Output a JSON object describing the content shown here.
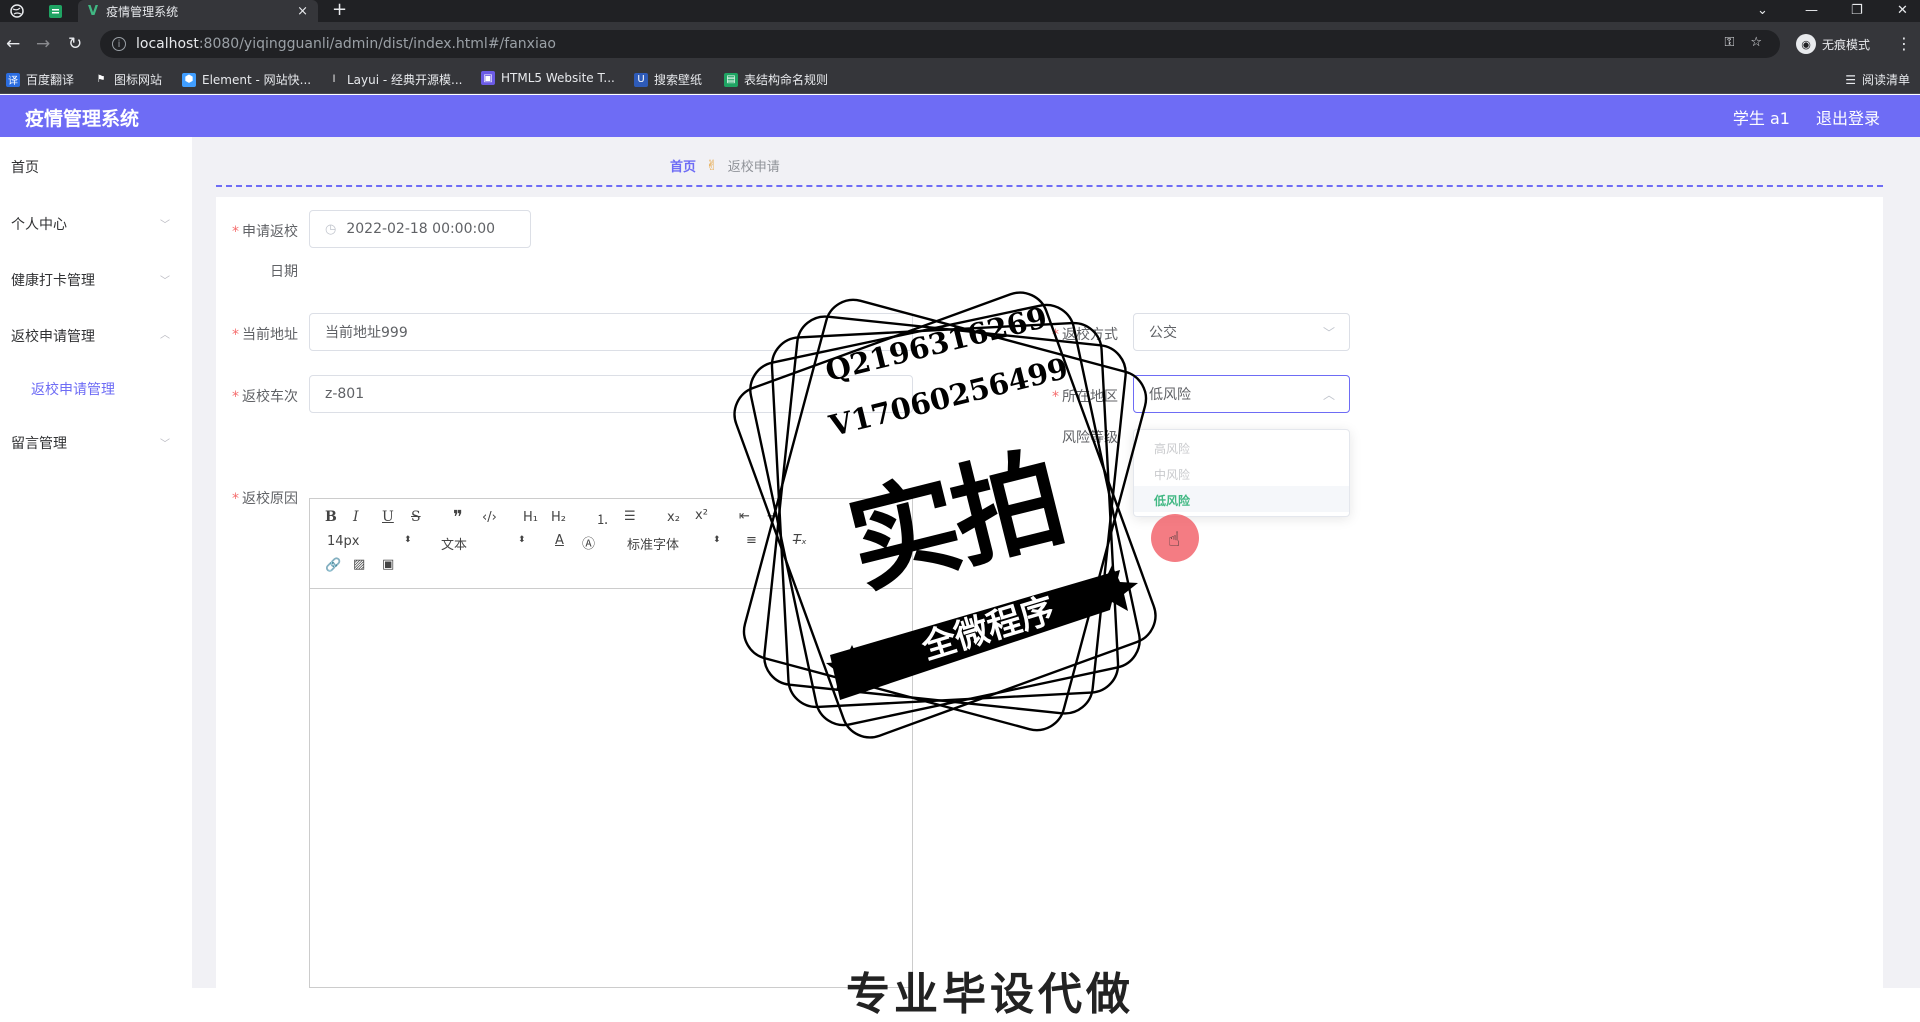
{
  "browser": {
    "tab_title": "疫情管理系统",
    "tab_close": "×",
    "new_tab": "+",
    "url_host": "localhost",
    "url_path": ":8080/yiqingguanli/admin/dist/index.html#/fanxiao",
    "incognito_label": "无痕模式",
    "reading_list": "阅读清单",
    "bookmarks": [
      {
        "label": "百度翻译"
      },
      {
        "label": "图标网站"
      },
      {
        "label": "Element - 网站快..."
      },
      {
        "label": "Layui - 经典开源模..."
      },
      {
        "label": "HTML5 Website T..."
      },
      {
        "label": "搜索壁纸"
      },
      {
        "label": "表结构命名规则"
      }
    ]
  },
  "header": {
    "app_name": "疫情管理系统",
    "user": "学生 a1",
    "logout": "退出登录"
  },
  "sidebar": {
    "items": [
      {
        "label": "首页"
      },
      {
        "label": "个人中心"
      },
      {
        "label": "健康打卡管理"
      },
      {
        "label": "返校申请管理"
      },
      {
        "label": "留言管理"
      }
    ],
    "submenu": {
      "label": "返校申请管理"
    }
  },
  "breadcrumb": {
    "home": "首页",
    "separator": "✌",
    "current": "返校申请"
  },
  "form": {
    "apply_date": {
      "label_line1": "申请返校",
      "label_line2": "日期",
      "value": "2022-02-18 00:00:00"
    },
    "address": {
      "label": "当前地址",
      "value": "当前地址999"
    },
    "return_method": {
      "label": "返校方式",
      "value": "公交"
    },
    "train": {
      "label": "返校车次",
      "value": "z-801"
    },
    "region": {
      "label": "所在地区",
      "value": "低风险"
    },
    "risk_level": {
      "label": "风险等级"
    },
    "reason": {
      "label": "返校原因"
    },
    "required_mark": "*"
  },
  "dropdown": {
    "options": [
      "高风险",
      "中风险",
      "低风险"
    ],
    "selected": "低风险"
  },
  "editor": {
    "font_size": "14px",
    "paragraph": "文本",
    "font_family": "标准字体"
  },
  "watermark": {
    "line1": "Q2196316269",
    "line2": "V17060256499",
    "big": "实拍",
    "banner": "全微程序",
    "bottom": "专业毕设代做"
  },
  "colors": {
    "accent": "#6e6cf5",
    "required": "#f56c6c",
    "selected_option": "#41b883"
  }
}
